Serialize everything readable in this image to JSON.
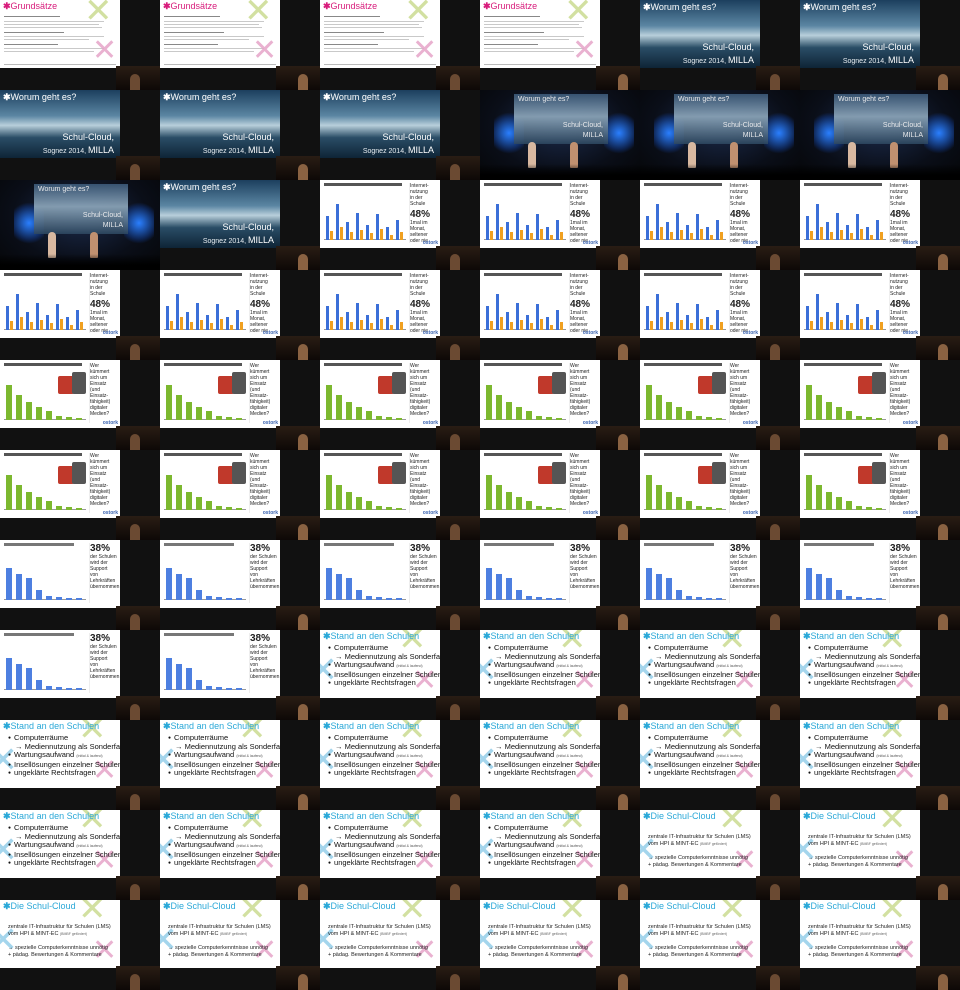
{
  "grundsaetze": {
    "title": "Grundsätze"
  },
  "worum": {
    "title": "Worum geht es?",
    "line1": "Schul-Cloud,",
    "line2_small": "Sognez 2014,",
    "line2_big": "MILLA"
  },
  "photo_title": "Worum geht es?",
  "internet_chart": {
    "side_title_lines": [
      "Internet-",
      "nutzung",
      "in der",
      "Schule"
    ],
    "big_value": "48%",
    "detail_lines": [
      "1mal im",
      "Monat,",
      "seltener",
      "oder nie"
    ],
    "logo": "ostork"
  },
  "kompetenz_chart": {
    "side_lines": [
      "Wer",
      "kümmert",
      "sich um",
      "Einsatz",
      "(und",
      "Einsatz-",
      "fähigkeit)",
      "digitaler",
      "Medien?"
    ],
    "logo": "ostork"
  },
  "prozent_chart": {
    "big_value": "38%",
    "side_lines": [
      "der Schulen",
      "wird der",
      "Support",
      "von",
      "Lehrkräften",
      "übernommen"
    ]
  },
  "stand": {
    "title": "Stand an den Schulen",
    "items": [
      {
        "text": "Computerräume",
        "indent": false
      },
      {
        "text": "→ Mediennutzung als Sonderfall",
        "indent": true
      },
      {
        "text": "Wartungsaufwand",
        "note": "(Initial & laufend)",
        "indent": false
      },
      {
        "text": "Insellösungen einzelner Schulen",
        "indent": false
      },
      {
        "text": "ungeklärte Rechtsfragen",
        "indent": false
      }
    ]
  },
  "cloud": {
    "title": "Die Schul-Cloud",
    "p1": "zentrale IT-Infrastruktur für Schulen (LMS)",
    "p2": "vom HPI & MINT-EC",
    "p2_note": "(BMBF gefördert)",
    "p3": "→ spezielle Computerkenntnisse unnötig",
    "p4": "+ pädag. Bewertungen & Kommentare"
  },
  "chart_data": [
    {
      "type": "bar",
      "series": [
        {
          "values": [
            55,
            82,
            40,
            62,
            35,
            58,
            30,
            45
          ]
        },
        {
          "values": [
            20,
            30,
            18,
            22,
            15,
            25,
            12,
            18
          ]
        }
      ]
    },
    {
      "type": "bar",
      "values": [
        80,
        56,
        42,
        30,
        20,
        8,
        6,
        4
      ]
    },
    {
      "type": "bar",
      "values": [
        72,
        58,
        50,
        22,
        8,
        6,
        5,
        4
      ]
    }
  ]
}
